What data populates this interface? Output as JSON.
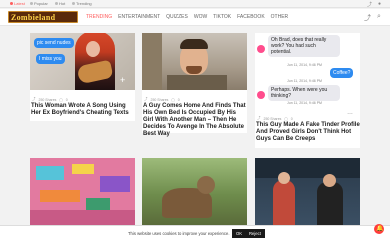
{
  "topbar": {
    "items": [
      "Latest",
      "Popular",
      "Hot",
      "Trending"
    ]
  },
  "header": {
    "logo_text": "Zombieland",
    "nav": [
      "Trending",
      "Entertainment",
      "Quizzes",
      "WOW",
      "TikTok",
      "Facebook",
      "Other"
    ]
  },
  "cards": [
    {
      "title": "This Woman Wrote A Song Using Her Ex Boyfriend's Cheating Texts",
      "shares": "250 Shares",
      "comments": "0",
      "bubbles": [
        "pic send nudes",
        "I miss you"
      ]
    },
    {
      "title": "A Guy Comes Home And Finds That His Own Bed Is Occupied By His Girl With Another Man – Then He Decides To Avenge In The Absolute Best Way",
      "shares": "250 Shares",
      "comments": "0"
    },
    {
      "title": "This Guy Made A Fake Tinder Profile And Proved Girls Don't Think Hot Guys Can Be Creeps",
      "shares": "250 Shares",
      "comments": "0",
      "chat": [
        {
          "side": "left",
          "text": "Oh Brad, does that really work? You had such potential."
        },
        {
          "stamp": "Jun 11, 2014, 9:46 PM"
        },
        {
          "side": "right",
          "text": "Coffee?"
        },
        {
          "stamp": "Jun 11, 2014, 9:46 PM"
        },
        {
          "side": "left",
          "text": "Perhaps. When were you thinking?"
        },
        {
          "stamp": "Jun 11, 2014, 9:46 PM"
        }
      ]
    }
  ],
  "cookie": {
    "text": "This website uses cookies to improve your experience.",
    "ok": "OK",
    "reject": "Reject"
  },
  "colors": {
    "accent": "#ff5e5e",
    "chat_blue": "#2e8bf0"
  }
}
